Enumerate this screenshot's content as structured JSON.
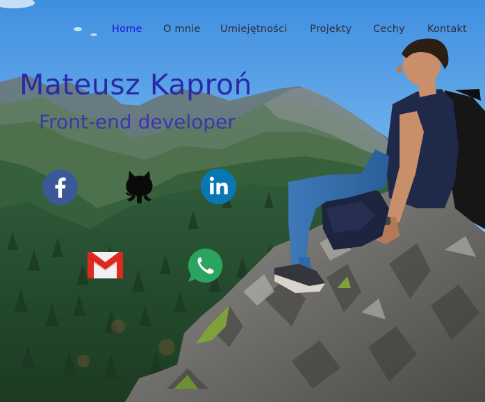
{
  "nav": {
    "items": [
      {
        "label": "Home",
        "active": true
      },
      {
        "label": "O mnie"
      },
      {
        "label": "Umiejętności"
      },
      {
        "label": "Projekty"
      },
      {
        "label": "Cechy"
      },
      {
        "label": "Kontakt"
      }
    ]
  },
  "hero": {
    "name": "Mateusz Kaproń",
    "role": "Front-end developer"
  },
  "social": [
    {
      "icon": "facebook-icon",
      "color": "#3b5998"
    },
    {
      "icon": "github-icon",
      "color": "#000000"
    },
    {
      "icon": "linkedin-icon",
      "color": "#0a77b5"
    },
    {
      "icon": "gmail-icon",
      "color": "#d93025"
    },
    {
      "icon": "whatsapp-icon",
      "color": "#25a05a"
    }
  ],
  "colors": {
    "nav_active": "#1a16d6",
    "nav_text": "#2c2c3a",
    "hero_text": "#2a2aa8"
  }
}
